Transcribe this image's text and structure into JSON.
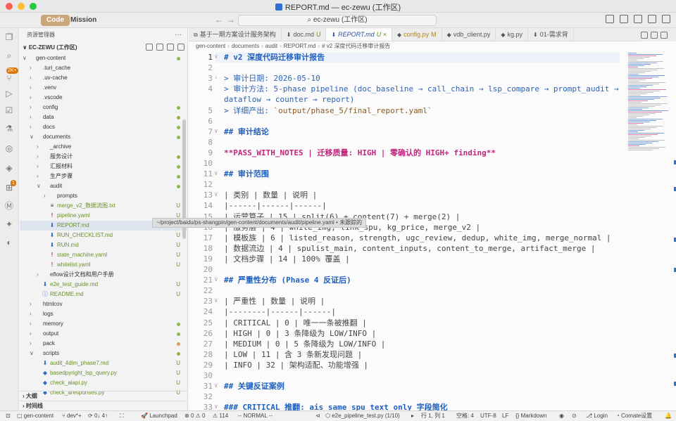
{
  "window": {
    "title": "REPORT.md — ec-zewu (工作区)"
  },
  "command_bar": {
    "mode_code": "Code",
    "mode_mission": "Mission",
    "back_arrow": "←",
    "forward_arrow": "→",
    "search_text": "ec-zewu (工作区)"
  },
  "activity": {
    "badge_extensions": "2K+",
    "badge_source": "1"
  },
  "sidebar": {
    "header": "资源管理器",
    "more": "···",
    "root": "EC-ZEWU (工作区)",
    "items": [
      {
        "label": "gen-content",
        "indent": 0,
        "kind": "folder-open",
        "status": "dot",
        "color": "green"
      },
      {
        "label": ".turi_cache",
        "indent": 1,
        "kind": "folder",
        "status": "",
        "color": ""
      },
      {
        "label": ".uv-cache",
        "indent": 1,
        "kind": "folder",
        "status": "",
        "color": ""
      },
      {
        "label": ".venv",
        "indent": 1,
        "kind": "folder",
        "status": "",
        "color": ""
      },
      {
        "label": ".vscode",
        "indent": 1,
        "kind": "folder",
        "status": "",
        "color": ""
      },
      {
        "label": "config",
        "indent": 1,
        "kind": "folder",
        "status": "dot",
        "color": ""
      },
      {
        "label": "data",
        "indent": 1,
        "kind": "folder",
        "status": "dot",
        "color": ""
      },
      {
        "label": "docs",
        "indent": 1,
        "kind": "folder",
        "status": "dot",
        "color": ""
      },
      {
        "label": "documents",
        "indent": 1,
        "kind": "folder-open",
        "status": "dot",
        "color": ""
      },
      {
        "label": "_archive",
        "indent": 2,
        "kind": "folder",
        "status": "",
        "color": ""
      },
      {
        "label": "服务设计",
        "indent": 2,
        "kind": "folder",
        "status": "dot",
        "color": ""
      },
      {
        "label": "汇报材料",
        "indent": 2,
        "kind": "folder",
        "status": "dot",
        "color": ""
      },
      {
        "label": "生产步骤",
        "indent": 2,
        "kind": "folder",
        "status": "dot",
        "color": ""
      },
      {
        "label": "audit",
        "indent": 2,
        "kind": "folder-open",
        "status": "dot",
        "color": ""
      },
      {
        "label": "prompts",
        "indent": 3,
        "kind": "folder",
        "status": "",
        "color": ""
      },
      {
        "label": "merge_v2_数据流图.txt",
        "indent": 3,
        "kind": "txt",
        "status": "U",
        "color": "green"
      },
      {
        "label": "pipeline.yaml",
        "indent": 3,
        "kind": "yaml",
        "status": "U",
        "color": "green"
      },
      {
        "label": "REPORT.md",
        "indent": 3,
        "kind": "md",
        "status": "U",
        "color": "green",
        "selected": true
      },
      {
        "label": "RUN_CHECKLIST.md",
        "indent": 3,
        "kind": "md",
        "status": "U",
        "color": "green"
      },
      {
        "label": "RUN.md",
        "indent": 3,
        "kind": "md",
        "status": "U",
        "color": "green"
      },
      {
        "label": "state_machine.yaml",
        "indent": 3,
        "kind": "yaml",
        "status": "U",
        "color": "green"
      },
      {
        "label": "whitelist.yaml",
        "indent": 3,
        "kind": "yaml",
        "status": "U",
        "color": "green"
      },
      {
        "label": "eflow设计文档和用户手册",
        "indent": 2,
        "kind": "folder",
        "status": "",
        "color": ""
      },
      {
        "label": "e2e_test_guide.md",
        "indent": 2,
        "kind": "md",
        "status": "U",
        "color": "green"
      },
      {
        "label": "README.md",
        "indent": 2,
        "kind": "info",
        "status": "U",
        "color": "green"
      },
      {
        "label": "htmlcov",
        "indent": 1,
        "kind": "folder",
        "status": "",
        "color": ""
      },
      {
        "label": "logs",
        "indent": 1,
        "kind": "folder",
        "status": "",
        "color": ""
      },
      {
        "label": "memory",
        "indent": 1,
        "kind": "folder",
        "status": "dot",
        "color": ""
      },
      {
        "label": "output",
        "indent": 1,
        "kind": "folder",
        "status": "dot",
        "color": ""
      },
      {
        "label": "pack",
        "indent": 1,
        "kind": "folder",
        "status": "dot-orange",
        "color": ""
      },
      {
        "label": "scripts",
        "indent": 1,
        "kind": "folder-open",
        "status": "dot",
        "color": ""
      },
      {
        "label": "audit_4dim_phase7.md",
        "indent": 2,
        "kind": "md",
        "status": "U",
        "color": "green"
      },
      {
        "label": "basedpyright_lsp_query.py",
        "indent": 2,
        "kind": "py",
        "status": "U",
        "color": "green"
      },
      {
        "label": "check_aiapi.py",
        "indent": 2,
        "kind": "py",
        "status": "U",
        "color": "green"
      },
      {
        "label": "check_aresponses.py",
        "indent": 2,
        "kind": "py",
        "status": "U",
        "color": "green"
      }
    ],
    "outline": "大纲",
    "timeline": "时间线"
  },
  "tooltip": "~/project/baidu/ps-shangpin/gen-content/documents/audit/pipeline.yaml • 未跟踪的",
  "tabs": [
    {
      "label": "基于一期方案设计服务架构",
      "icon": "⧉",
      "status": "",
      "active": false
    },
    {
      "label": "doc.md",
      "icon": "⬇",
      "status": "U",
      "active": false
    },
    {
      "label": "REPORT.md",
      "icon": "⬇",
      "status": "U ×",
      "active": true
    },
    {
      "label": "config.py",
      "icon": "◆",
      "status": "M",
      "active": false
    },
    {
      "label": "vdb_client.py",
      "icon": "◆",
      "status": "",
      "active": false
    },
    {
      "label": "kg.py",
      "icon": "◆",
      "status": "",
      "active": false
    },
    {
      "label": "01-需求背",
      "icon": "⬇",
      "status": "",
      "active": false
    }
  ],
  "breadcrumb": [
    "gen-content",
    "documents",
    "audit",
    "REPORT.md",
    "# v2 深度代码迁移审计报告"
  ],
  "editor": {
    "lines": [
      {
        "n": "1",
        "fold": "∨",
        "kind": "heading",
        "text": "# v2 深度代码迁移审计报告"
      },
      {
        "n": "2",
        "fold": "",
        "kind": "plain",
        "text": ""
      },
      {
        "n": "3",
        "fold": "›",
        "kind": "quote",
        "text": "> 审计日期: 2026-05-10"
      },
      {
        "n": "4",
        "fold": "",
        "kind": "quote",
        "text": "> 审计方法: 5-phase pipeline (doc_baseline → call_chain → lsp_compare → prompt_audit →"
      },
      {
        "n": "",
        "fold": "",
        "kind": "quote",
        "text": "dataflow → counter → report)"
      },
      {
        "n": "5",
        "fold": "",
        "kind": "quote-inline",
        "text": "> 详细产出: ",
        "inline": "`output/phase_5/final_report.yaml`"
      },
      {
        "n": "6",
        "fold": "",
        "kind": "plain",
        "text": ""
      },
      {
        "n": "7",
        "fold": "∨",
        "kind": "heading",
        "text": "## 审计结论"
      },
      {
        "n": "8",
        "fold": "",
        "kind": "plain",
        "text": ""
      },
      {
        "n": "9",
        "fold": "",
        "kind": "bold",
        "text": "**PASS_WITH_NOTES | 迁移质量: HIGH | 零确认的 HIGH+ finding**"
      },
      {
        "n": "10",
        "fold": "",
        "kind": "plain",
        "text": ""
      },
      {
        "n": "11",
        "fold": "∨",
        "kind": "heading",
        "text": "## 审计范围"
      },
      {
        "n": "12",
        "fold": "",
        "kind": "plain",
        "text": ""
      },
      {
        "n": "13",
        "fold": "∨",
        "kind": "table",
        "text": "| 类别 | 数量 | 说明 |"
      },
      {
        "n": "14",
        "fold": "",
        "kind": "table",
        "text": "|------|------|------|"
      },
      {
        "n": "15",
        "fold": "",
        "kind": "table",
        "text": "| 运营算子 | 15 | split(6) + content(7) + merge(2) |"
      },
      {
        "n": "16",
        "fold": "",
        "kind": "table",
        "text": "| 服务层 | 4 | white_img, link_spu, kg_price, merge_v2 |"
      },
      {
        "n": "17",
        "fold": "",
        "kind": "table",
        "text": "| 模板族 | 6 | listed_reason, strength, ugc_review, dedup, white_img, merge_normal |"
      },
      {
        "n": "18",
        "fold": "",
        "kind": "table",
        "text": "| 数据流边 | 4 | spulist_main, content_inputs, content_to_merge, artifact_merge |"
      },
      {
        "n": "19",
        "fold": "",
        "kind": "table",
        "text": "| 文档步骤 | 14 | 100% 覆盖 |"
      },
      {
        "n": "20",
        "fold": "",
        "kind": "plain",
        "text": ""
      },
      {
        "n": "21",
        "fold": "∨",
        "kind": "heading",
        "text": "## 严重性分布 (Phase 4 反证后)"
      },
      {
        "n": "22",
        "fold": "",
        "kind": "plain",
        "text": ""
      },
      {
        "n": "23",
        "fold": "∨",
        "kind": "table",
        "text": "| 严重性 | 数量 | 说明 |"
      },
      {
        "n": "24",
        "fold": "",
        "kind": "table",
        "text": "|--------|------|------|"
      },
      {
        "n": "25",
        "fold": "",
        "kind": "table",
        "text": "| CRITICAL | 0 | 唯一一条被推翻 |"
      },
      {
        "n": "26",
        "fold": "",
        "kind": "table",
        "text": "| HIGH | 0 | 3 条降级为 LOW/INFO |"
      },
      {
        "n": "27",
        "fold": "",
        "kind": "table",
        "text": "| MEDIUM | 0 | 5 条降级为 LOW/INFO |"
      },
      {
        "n": "28",
        "fold": "",
        "kind": "table",
        "text": "| LOW | 11 | 含 3 条新发现问题 |"
      },
      {
        "n": "29",
        "fold": "",
        "kind": "table",
        "text": "| INFO | 32 | 架构适配、功能增强 |"
      },
      {
        "n": "30",
        "fold": "",
        "kind": "plain",
        "text": ""
      },
      {
        "n": "31",
        "fold": "∨",
        "kind": "heading",
        "text": "## 关键反证案例"
      },
      {
        "n": "32",
        "fold": "",
        "kind": "plain",
        "text": ""
      },
      {
        "n": "33",
        "fold": "∨",
        "kind": "heading",
        "text": "### CRITICAL 推翻: ais_same_spu_text_only 字段简化"
      }
    ]
  },
  "statusbar": {
    "branch_folder": "gen-content",
    "branch": "dev*+",
    "sync": "0↓ 4↑",
    "launchpad": "Launchpad",
    "problems": "0 ⚠ 0",
    "info": "114",
    "vim_mode": "-- NORMAL --",
    "file": "e2e_pipeline_test.py (1/10)",
    "position": "行 1, 列 1",
    "spaces": "空格: 4",
    "encoding": "UTF-8",
    "eol": "LF",
    "language": "Markdown",
    "login": "Login",
    "comate": "Comate设置"
  },
  "colors": {
    "accent": "#2f6fd6",
    "heading": "#1f5fbf",
    "bold": "#c0267d",
    "untracked": "#6c8f2d",
    "modified": "#b3861f"
  }
}
